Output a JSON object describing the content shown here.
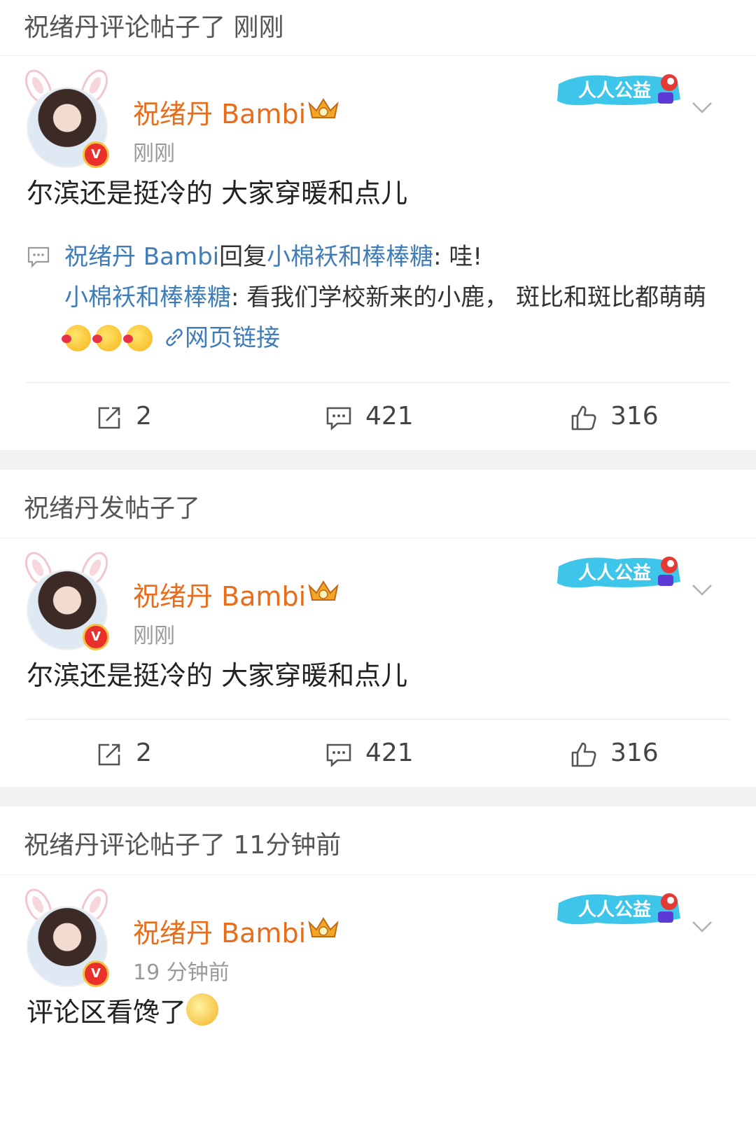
{
  "feed": [
    {
      "header": "祝绪丹评论帖子了 刚刚",
      "username": "祝绪丹 Bambi",
      "timestamp": "刚刚",
      "badge_text": "人人公益",
      "text": "尔滨还是挺冷的 大家穿暖和点儿",
      "reply": {
        "author": "祝绪丹 Bambi",
        "verb": "回复",
        "target": "小棉袄和棒棒糖",
        "message": ": 哇!",
        "quote_author": "小棉袄和棒棒糖",
        "quote_message": ": 看我们学校新来的小鹿， 斑比和斑比都萌萌",
        "link_label": "网页链接"
      },
      "reposts": "2",
      "comments": "421",
      "likes": "316"
    },
    {
      "header": "祝绪丹发帖子了",
      "username": "祝绪丹 Bambi",
      "timestamp": "刚刚",
      "badge_text": "人人公益",
      "text": "尔滨还是挺冷的 大家穿暖和点儿",
      "reposts": "2",
      "comments": "421",
      "likes": "316"
    },
    {
      "header": "祝绪丹评论帖子了 11分钟前",
      "username": "祝绪丹 Bambi",
      "timestamp": "19 分钟前",
      "badge_text": "人人公益",
      "text": "评论区看馋了"
    }
  ],
  "colors": {
    "username": "#e86c1a",
    "link": "#3f7cba",
    "muted": "#999999",
    "separator": "#f2f2f2"
  },
  "icons": {
    "repost": "repost-icon",
    "comment": "comment-icon",
    "like": "like-icon",
    "chevron": "chevron-down-icon",
    "verified": "verified-v-icon",
    "crown": "crown-icon"
  }
}
